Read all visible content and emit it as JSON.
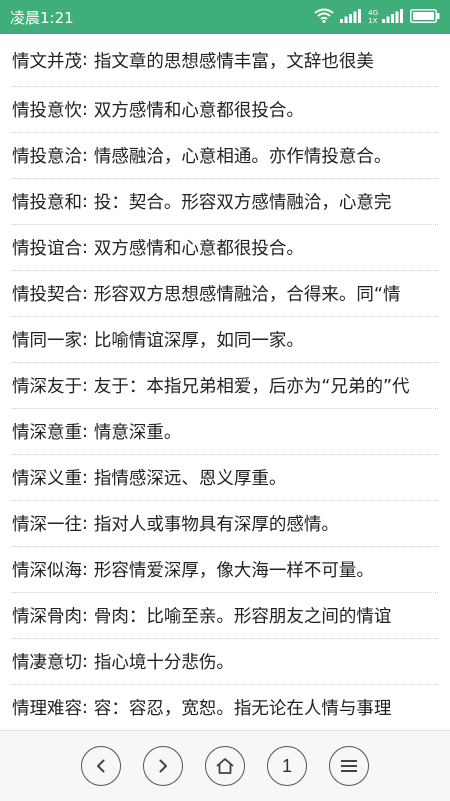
{
  "status_bar": {
    "time": "凌晨1:21",
    "network_type": "4G",
    "sim_label": "1X",
    "battery_icon": "battery-icon",
    "wifi_icon": "wifi-icon",
    "signal_icon": "signal-icon"
  },
  "entries": [
    {
      "term": "情文并茂",
      "separator": ":",
      "definition": "指文章的思想感情丰富，文辞也很美"
    },
    {
      "term": "情投意忺",
      "separator": ":",
      "definition": "双方感情和心意都很投合。"
    },
    {
      "term": "情投意洽",
      "separator": ":",
      "definition": "情感融洽，心意相通。亦作情投意合。"
    },
    {
      "term": "情投意和",
      "separator": ":",
      "definition": "投：契合。形容双方感情融洽，心意完"
    },
    {
      "term": "情投谊合",
      "separator": ":",
      "definition": "双方感情和心意都很投合。"
    },
    {
      "term": "情投契合",
      "separator": ":",
      "definition": "形容双方思想感情融洽，合得来。同“情"
    },
    {
      "term": "情同一家",
      "separator": ":",
      "definition": "比喻情谊深厚，如同一家。"
    },
    {
      "term": "情深友于",
      "separator": ":",
      "definition": "友于：本指兄弟相爱，后亦为“兄弟的”代"
    },
    {
      "term": "情深意重",
      "separator": ":",
      "definition": "情意深重。"
    },
    {
      "term": "情深义重",
      "separator": ":",
      "definition": "指情感深远、恩义厚重。"
    },
    {
      "term": "情深一往",
      "separator": ":",
      "definition": "指对人或事物具有深厚的感情。"
    },
    {
      "term": "情深似海",
      "separator": ":",
      "definition": "形容情爱深厚，像大海一样不可量。"
    },
    {
      "term": "情深骨肉",
      "separator": ":",
      "definition": "骨肉：比喻至亲。形容朋友之间的情谊"
    },
    {
      "term": "情凄意切",
      "separator": ":",
      "definition": "指心境十分悲伤。"
    },
    {
      "term": "情理难容",
      "separator": ":",
      "definition": "容：容忍，宽恕。指无论在人情与事理"
    }
  ],
  "toolbar": {
    "back_icon": "chevron-left-icon",
    "forward_icon": "chevron-right-icon",
    "home_icon": "home-icon",
    "page_number": "1",
    "menu_icon": "menu-icon"
  }
}
